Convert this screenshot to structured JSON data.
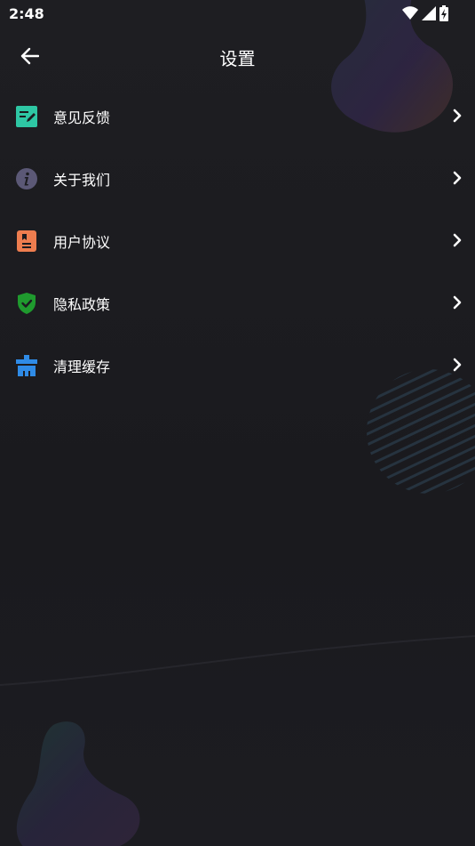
{
  "status_bar": {
    "time": "2:48",
    "icons": [
      "wifi-icon",
      "signal-icon",
      "battery-charging-icon"
    ]
  },
  "header": {
    "title": "设置",
    "back_icon": "arrow-left-icon"
  },
  "menu": {
    "items": [
      {
        "label": "意见反馈",
        "icon": "feedback-icon",
        "icon_color": "#2ec7a4"
      },
      {
        "label": "关于我们",
        "icon": "info-icon",
        "icon_color": "#5b5876"
      },
      {
        "label": "用户协议",
        "icon": "user-agreement-icon",
        "icon_color": "#ee7d4f"
      },
      {
        "label": "隐私政策",
        "icon": "shield-check-icon",
        "icon_color": "#1f9a2e"
      },
      {
        "label": "清理缓存",
        "icon": "clear-cache-icon",
        "icon_color": "#2f8be6"
      }
    ],
    "chevron_icon": "chevron-right-icon"
  },
  "colors": {
    "background": "#1b1b1f",
    "text": "#ffffff"
  }
}
